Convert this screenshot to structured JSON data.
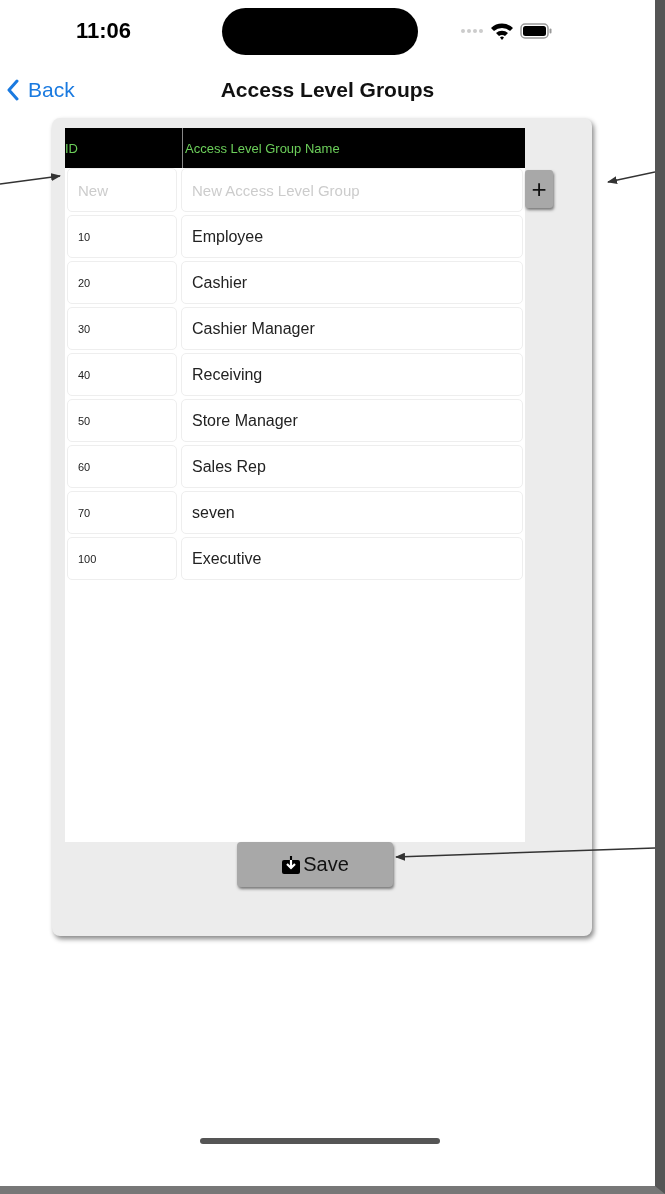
{
  "status_bar": {
    "time": "11:06"
  },
  "nav": {
    "back": "Back",
    "title": "Access Level Groups"
  },
  "table": {
    "columns": [
      "ID",
      "Access Level Group Name"
    ],
    "new_row": {
      "id_placeholder": "New",
      "name_placeholder": "New Access Level Group",
      "add": "+"
    },
    "rows": [
      {
        "id": "10",
        "name": "Employee"
      },
      {
        "id": "20",
        "name": "Cashier"
      },
      {
        "id": "30",
        "name": "Cashier Manager"
      },
      {
        "id": "40",
        "name": "Receiving"
      },
      {
        "id": "50",
        "name": "Store Manager"
      },
      {
        "id": "60",
        "name": "Sales Rep"
      },
      {
        "id": "70",
        "name": "seven"
      },
      {
        "id": "100",
        "name": "Executive"
      }
    ]
  },
  "save_button": "Save"
}
